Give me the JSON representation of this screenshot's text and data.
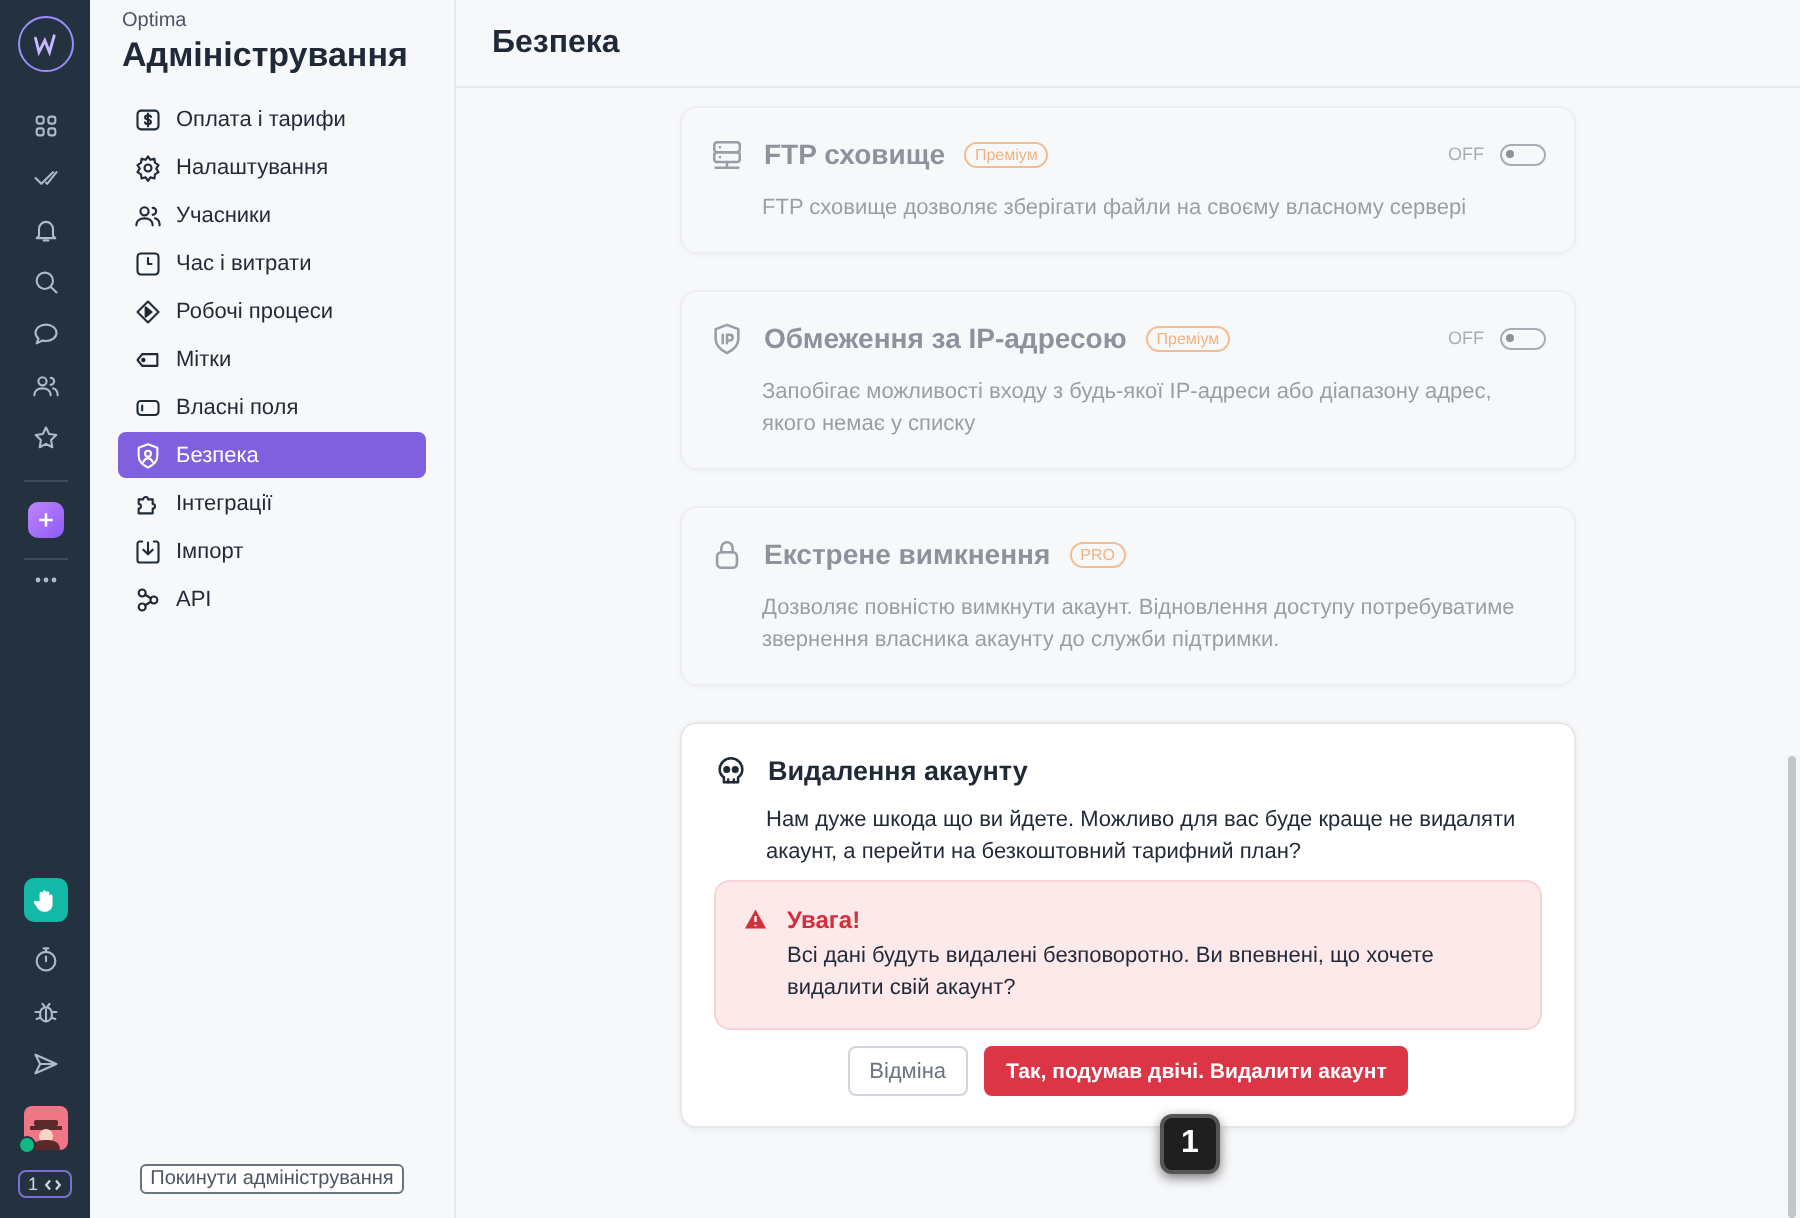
{
  "rail": {
    "online": true,
    "counter": "1"
  },
  "sidebar": {
    "org": "Optima",
    "title": "Адміністрування",
    "items": [
      {
        "label": "Оплата і тарифи",
        "selected": false
      },
      {
        "label": "Налаштування",
        "selected": false
      },
      {
        "label": "Учасники",
        "selected": false
      },
      {
        "label": "Час і витрати",
        "selected": false
      },
      {
        "label": "Робочі процеси",
        "selected": false
      },
      {
        "label": "Мітки",
        "selected": false
      },
      {
        "label": "Власні поля",
        "selected": false
      },
      {
        "label": "Безпека",
        "selected": true
      },
      {
        "label": "Інтеграції",
        "selected": false
      },
      {
        "label": "Імпорт",
        "selected": false
      },
      {
        "label": "API",
        "selected": false
      }
    ],
    "leave_button": "Покинути адміністрування"
  },
  "main": {
    "title": "Безпека",
    "features": [
      {
        "title": "FTP сховище",
        "badge": "Преміум",
        "description": "FTP сховище дозволяє зберігати файли на своєму власному сервері",
        "disabled": true,
        "toggle": {
          "label": "OFF",
          "on": false
        }
      },
      {
        "title": "Обмеження за IP-адресою",
        "badge": "Преміум",
        "description": "Запобігає можливості входу з будь-якої IP-адреси або діапазону адрес, якого немає у списку",
        "disabled": true,
        "toggle": {
          "label": "OFF",
          "on": false
        }
      },
      {
        "title": "Екстрене вимкнення",
        "badge": "PRO",
        "description": "Дозволяє повністю вимкнути акаунт. Відновлення доступу потребуватиме звернення власника акаунту до служби підтримки.",
        "disabled": true
      }
    ],
    "delete_card": {
      "title": "Видалення акаунту",
      "text": "Нам дуже шкода що ви йдете. Можливо для вас буде краще не видаляти акаунт, а перейти на безкоштовний тарифний план?",
      "alert": {
        "title": "Увага!",
        "text": "Всі дані будуть видалені безповоротно. Ви впевнені, що хочете видалити свій акаунт?"
      },
      "cancel_button": "Відміна",
      "confirm_button": "Так, подумав двічі. Видалити акаунт"
    },
    "step_marker": "1"
  }
}
